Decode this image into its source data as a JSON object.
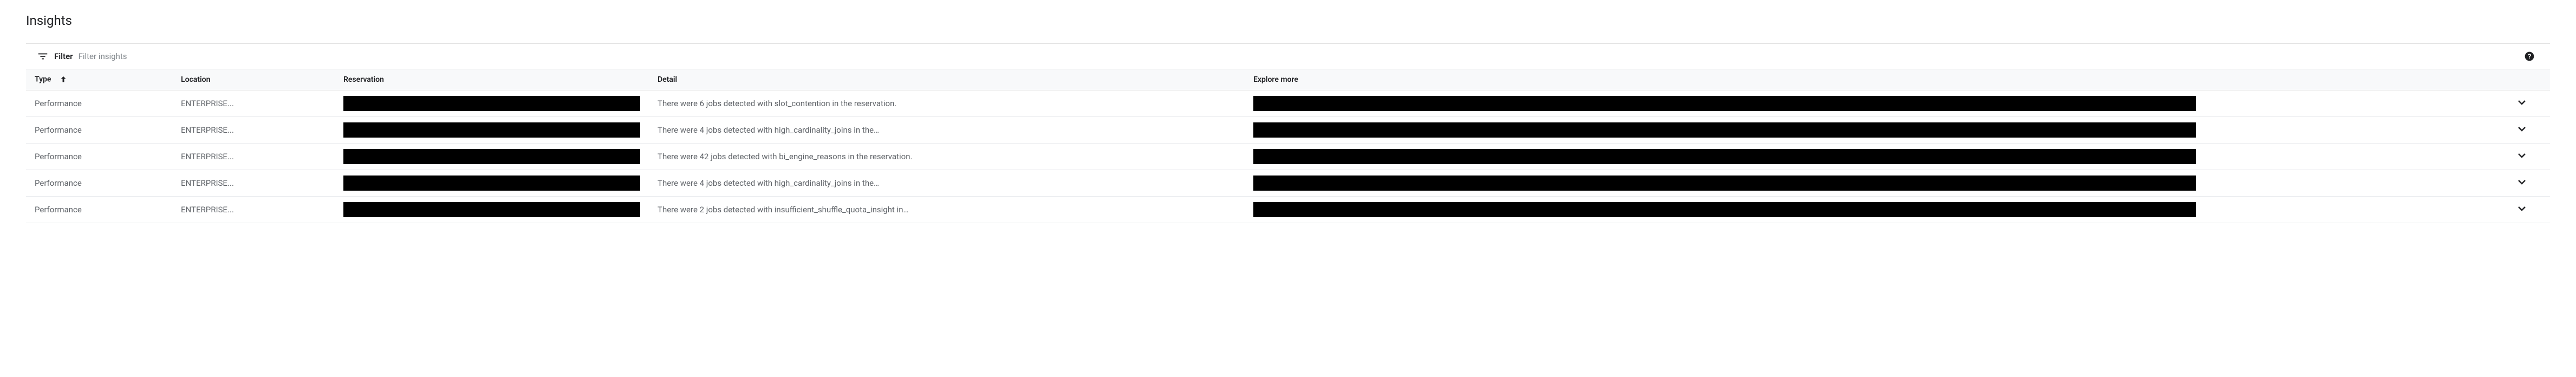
{
  "page": {
    "title": "Insights"
  },
  "filter": {
    "label": "Filter",
    "placeholder": "Filter insights"
  },
  "columns": {
    "type": "Type",
    "location": "Location",
    "reservation": "Reservation",
    "detail": "Detail",
    "explore": "Explore more"
  },
  "rows": [
    {
      "type": "Performance",
      "location": "ENTERPRISE...",
      "detail": "There were 6 jobs detected with slot_contention in the reservation."
    },
    {
      "type": "Performance",
      "location": "ENTERPRISE...",
      "detail": "There were 4 jobs detected with high_cardinality_joins in the…"
    },
    {
      "type": "Performance",
      "location": "ENTERPRISE...",
      "detail": "There were 42 jobs detected with bi_engine_reasons in the reservation."
    },
    {
      "type": "Performance",
      "location": "ENTERPRISE...",
      "detail": "There were 4 jobs detected with high_cardinality_joins in the…"
    },
    {
      "type": "Performance",
      "location": "ENTERPRISE...",
      "detail": "There were 2 jobs detected with insufficient_shuffle_quota_insight in…"
    }
  ]
}
